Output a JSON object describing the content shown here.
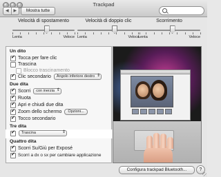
{
  "window": {
    "title": "Trackpad"
  },
  "toolbar": {
    "back": "◀",
    "forward": "▶",
    "show_all": "Mostra tutte",
    "search_placeholder": ""
  },
  "sliders": [
    {
      "title": "Velocità di spostamento",
      "min": "Lenta",
      "max": "Veloce",
      "value": 0.55
    },
    {
      "title": "Velocità di doppio clic",
      "min": "Lenta",
      "max": "Veloce",
      "value": 0.6
    },
    {
      "title": "Scorrimento",
      "min": "Lenta",
      "max": "Veloce",
      "value": 0.55
    }
  ],
  "sections": {
    "one_finger": "Un dito",
    "two_fingers": "Due dita",
    "three_fingers": "Tre dita",
    "four_fingers": "Quattro dita"
  },
  "options": {
    "tap_click": "Tocca per fare clic",
    "drag": "Trascina",
    "drag_lock": "Blocco trascinamento",
    "secondary_click": "Clic secondario",
    "secondary_click_value": "Angolo inferiore destro",
    "scroll": "Scorri",
    "scroll_value": "con inerzia",
    "rotate": "Ruota",
    "pinch": "Apri e chiudi due dita",
    "zoom": "Zoom dello schermo",
    "zoom_button": "Opzioni...",
    "secondary_tap": "Tocco secondario",
    "three_drag_value": "Trascina",
    "expose": "Scorri Su/Giù per Exposé",
    "switch_apps": "Scorri a dx o sx per cambiare applicazione"
  },
  "checks": {
    "tap_click": true,
    "drag": false,
    "drag_lock": false,
    "secondary_click": true,
    "scroll": true,
    "rotate": true,
    "pinch": true,
    "zoom": true,
    "secondary_tap": true,
    "three_drag": true,
    "expose": true,
    "switch_apps": true
  },
  "bottom": {
    "bluetooth_button": "Configura trackpad Bluetooth...",
    "help": "?"
  }
}
